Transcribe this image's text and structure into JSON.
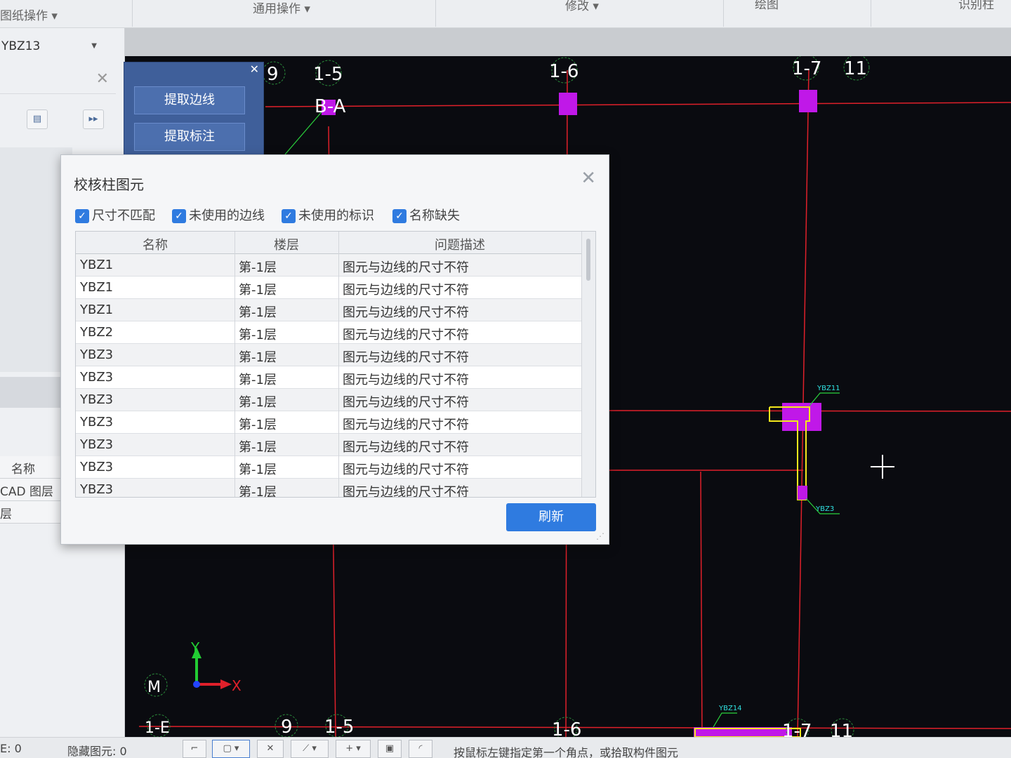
{
  "ribbon": {
    "groups": [
      "图纸操作",
      "通用操作",
      "修改",
      "绘图",
      "识别柱"
    ]
  },
  "left_panel": {
    "combo_value": "YBZ13",
    "prop_rows": [
      "名称",
      "CAD 图层",
      "层"
    ]
  },
  "extract_panel": {
    "btn_edge": "提取边线",
    "btn_label": "提取标注"
  },
  "dialog": {
    "title": "校核柱图元",
    "filters": [
      {
        "label": "尺寸不匹配",
        "checked": true
      },
      {
        "label": "未使用的边线",
        "checked": true
      },
      {
        "label": "未使用的标识",
        "checked": true
      },
      {
        "label": "名称缺失",
        "checked": true
      }
    ],
    "columns": [
      "名称",
      "楼层",
      "问题描述"
    ],
    "rows": [
      [
        "YBZ1",
        "第-1层",
        "图元与边线的尺寸不符"
      ],
      [
        "YBZ1",
        "第-1层",
        "图元与边线的尺寸不符"
      ],
      [
        "YBZ1",
        "第-1层",
        "图元与边线的尺寸不符"
      ],
      [
        "YBZ2",
        "第-1层",
        "图元与边线的尺寸不符"
      ],
      [
        "YBZ3",
        "第-1层",
        "图元与边线的尺寸不符"
      ],
      [
        "YBZ3",
        "第-1层",
        "图元与边线的尺寸不符"
      ],
      [
        "YBZ3",
        "第-1层",
        "图元与边线的尺寸不符"
      ],
      [
        "YBZ3",
        "第-1层",
        "图元与边线的尺寸不符"
      ],
      [
        "YBZ3",
        "第-1层",
        "图元与边线的尺寸不符"
      ],
      [
        "YBZ3",
        "第-1层",
        "图元与边线的尺寸不符"
      ],
      [
        "YBZ3",
        "第-1层",
        "图元与边线的尺寸不符"
      ]
    ],
    "refresh_label": "刷新"
  },
  "cad": {
    "axis_top": [
      "9",
      "1-5",
      "1-6",
      "1-7",
      "11"
    ],
    "axis_bottom": [
      "9",
      "1-5",
      "1-6",
      "1-7",
      "11"
    ],
    "axis_left": [
      "M",
      "1-E"
    ],
    "axis_row_label": "B-A",
    "column_tags": [
      "YBZ11",
      "YBZ3",
      "YBZ14"
    ],
    "ucs_x": "X",
    "ucs_y": "Y"
  },
  "statusbar": {
    "count_label": "E: 0",
    "hidden_label": "隐藏图元: 0",
    "hint": "按鼠标左键指定第一个角点，或拾取构件图元"
  },
  "colors": {
    "canvas_bg": "#0a0b10",
    "axis_line": "#e0202a",
    "column_fill": "#c018e8",
    "outline_yellow": "#f4e81c",
    "tag_green": "#2ad23c",
    "dialog_accent": "#2f7be0"
  }
}
